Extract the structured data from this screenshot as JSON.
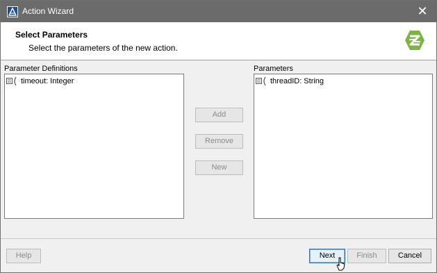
{
  "window": {
    "title": "Action Wizard",
    "close_glyph": "✕"
  },
  "header": {
    "title": "Select Parameters",
    "subtitle": "Select the parameters of the new action.",
    "logo_icon": "wizard-logo-icon"
  },
  "left_panel": {
    "label": "Parameter Definitions",
    "items": [
      {
        "text": "timeout: Integer",
        "icon": "parameter-icon"
      }
    ]
  },
  "right_panel": {
    "label": "Parameters",
    "items": [
      {
        "text": "threadID: String",
        "icon": "parameter-icon"
      }
    ]
  },
  "middle_buttons": {
    "add": "Add",
    "remove": "Remove",
    "new": "New"
  },
  "footer": {
    "help": "Help",
    "next": "Next",
    "finish": "Finish",
    "cancel": "Cancel"
  },
  "colors": {
    "titlebar": "#6b6b6b",
    "logo_green": "#7cb342",
    "default_button_border": "#2f6fb5"
  }
}
